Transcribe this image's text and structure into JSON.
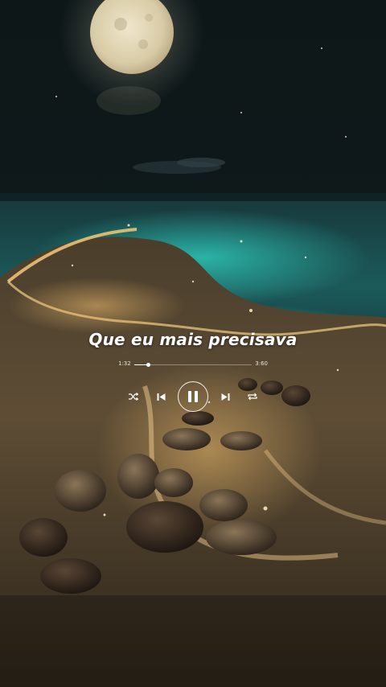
{
  "lyric": {
    "line": "Que eu mais precisava"
  },
  "player": {
    "elapsed": "1:32",
    "total": "3:60",
    "progress_fraction": 0.12,
    "controls": {
      "shuffle_icon": "shuffle-icon",
      "previous_icon": "skip-previous-icon",
      "play_state_icon": "pause-icon",
      "next_icon": "skip-next-icon",
      "repeat_icon": "repeat-icon"
    }
  },
  "colors": {
    "text": "#ffffff",
    "sea_glow": "#2bd4c0",
    "sand_glow": "#d9a860",
    "moon": "#e9dfc4"
  }
}
